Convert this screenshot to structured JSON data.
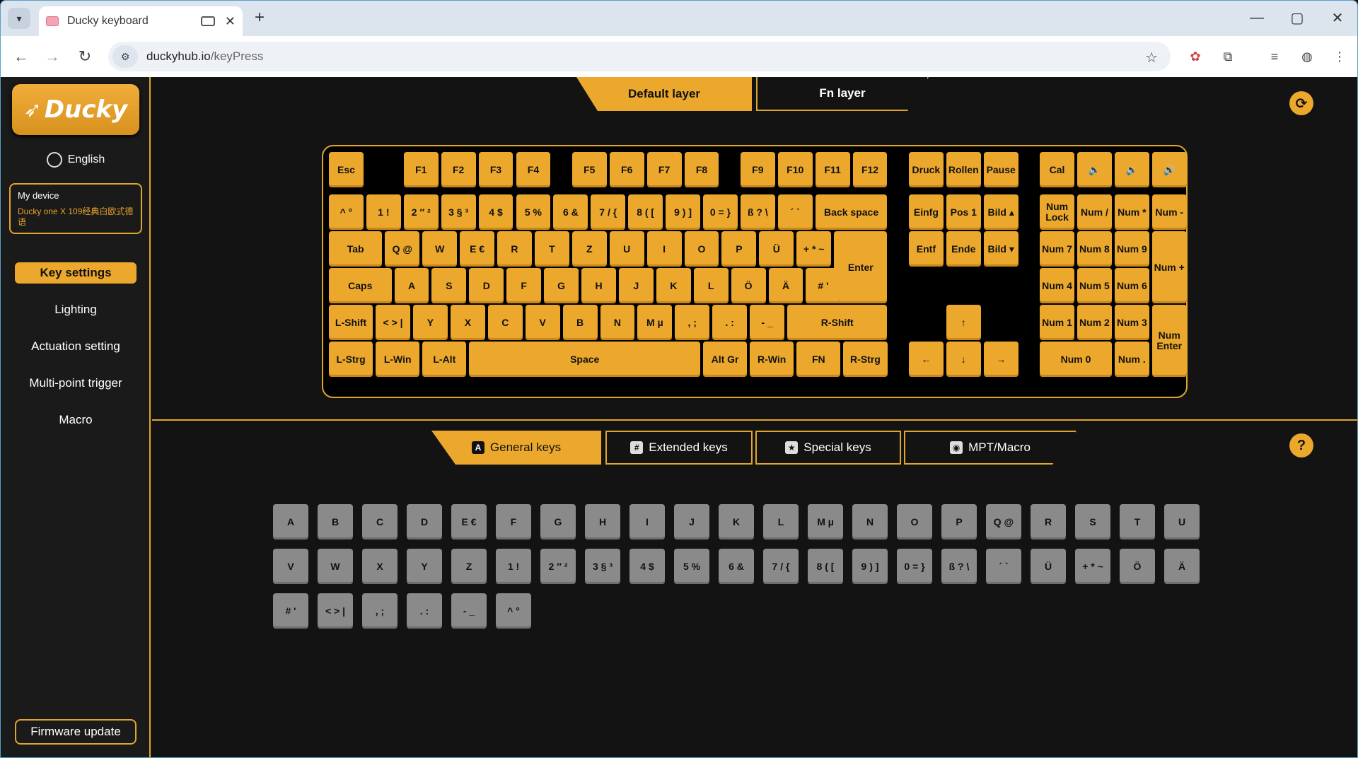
{
  "browser": {
    "tab_title": "Ducky keyboard",
    "url_domain": "duckyhub.io",
    "url_path": "/keyPress",
    "new_tab": "+",
    "tab_close": "✕"
  },
  "sidebar": {
    "logo": "Ducky",
    "language": "English",
    "device_title": "My device",
    "device_name": "Ducky one X 109经典白欧式德语",
    "items": [
      {
        "label": "Key settings",
        "active": true
      },
      {
        "label": "Lighting"
      },
      {
        "label": "Actuation setting"
      },
      {
        "label": "Multi-point trigger"
      },
      {
        "label": "Macro"
      }
    ],
    "firmware": "Firmware update"
  },
  "layers": {
    "default": "Default layer",
    "fn": "Fn layer"
  },
  "keyboard": {
    "keys": [
      {
        "label": "Esc",
        "r": 0,
        "c": 0,
        "w": 1
      },
      {
        "label": "F1",
        "r": 0,
        "c": 2,
        "w": 1
      },
      {
        "label": "F2",
        "r": 0,
        "c": 3,
        "w": 1
      },
      {
        "label": "F3",
        "r": 0,
        "c": 4,
        "w": 1
      },
      {
        "label": "F4",
        "r": 0,
        "c": 5,
        "w": 1
      },
      {
        "label": "F5",
        "r": 0,
        "c": 6.5,
        "w": 1
      },
      {
        "label": "F6",
        "r": 0,
        "c": 7.5,
        "w": 1
      },
      {
        "label": "F7",
        "r": 0,
        "c": 8.5,
        "w": 1
      },
      {
        "label": "F8",
        "r": 0,
        "c": 9.5,
        "w": 1
      },
      {
        "label": "F9",
        "r": 0,
        "c": 11,
        "w": 1
      },
      {
        "label": "F10",
        "r": 0,
        "c": 12,
        "w": 1
      },
      {
        "label": "F11",
        "r": 0,
        "c": 13,
        "w": 1
      },
      {
        "label": "F12",
        "r": 0,
        "c": 14,
        "w": 1
      },
      {
        "label": "^ °",
        "r": 1,
        "c": 0,
        "w": 1
      },
      {
        "label": "1 !",
        "r": 1,
        "c": 1,
        "w": 1
      },
      {
        "label": "2 ″ ²",
        "r": 1,
        "c": 2,
        "w": 1
      },
      {
        "label": "3 § ³",
        "r": 1,
        "c": 3,
        "w": 1
      },
      {
        "label": "4 $",
        "r": 1,
        "c": 4,
        "w": 1
      },
      {
        "label": "5 %",
        "r": 1,
        "c": 5,
        "w": 1
      },
      {
        "label": "6 &",
        "r": 1,
        "c": 6,
        "w": 1
      },
      {
        "label": "7 / {",
        "r": 1,
        "c": 7,
        "w": 1
      },
      {
        "label": "8 ( [",
        "r": 1,
        "c": 8,
        "w": 1
      },
      {
        "label": "9 ) ]",
        "r": 1,
        "c": 9,
        "w": 1
      },
      {
        "label": "0 = }",
        "r": 1,
        "c": 10,
        "w": 1
      },
      {
        "label": "ß ? \\",
        "r": 1,
        "c": 11,
        "w": 1
      },
      {
        "label": "´ `",
        "r": 1,
        "c": 12,
        "w": 1
      },
      {
        "label": "Back space",
        "r": 1,
        "c": 13,
        "w": 2
      },
      {
        "label": "Tab",
        "r": 2,
        "c": 0,
        "w": 1.5
      },
      {
        "label": "Q @",
        "r": 2,
        "c": 1.5,
        "w": 1
      },
      {
        "label": "W",
        "r": 2,
        "c": 2.5,
        "w": 1
      },
      {
        "label": "E €",
        "r": 2,
        "c": 3.5,
        "w": 1
      },
      {
        "label": "R",
        "r": 2,
        "c": 4.5,
        "w": 1
      },
      {
        "label": "T",
        "r": 2,
        "c": 5.5,
        "w": 1
      },
      {
        "label": "Z",
        "r": 2,
        "c": 6.5,
        "w": 1
      },
      {
        "label": "U",
        "r": 2,
        "c": 7.5,
        "w": 1
      },
      {
        "label": "I",
        "r": 2,
        "c": 8.5,
        "w": 1
      },
      {
        "label": "O",
        "r": 2,
        "c": 9.5,
        "w": 1
      },
      {
        "label": "P",
        "r": 2,
        "c": 10.5,
        "w": 1
      },
      {
        "label": "Ü",
        "r": 2,
        "c": 11.5,
        "w": 1
      },
      {
        "label": "+ * ~",
        "r": 2,
        "c": 12.5,
        "w": 1
      },
      {
        "label": "Enter",
        "r": 2,
        "c": 13.5,
        "w": 1.5,
        "h": 2
      },
      {
        "label": "Caps",
        "r": 3,
        "c": 0,
        "w": 1.75
      },
      {
        "label": "A",
        "r": 3,
        "c": 1.75,
        "w": 1
      },
      {
        "label": "S",
        "r": 3,
        "c": 2.75,
        "w": 1
      },
      {
        "label": "D",
        "r": 3,
        "c": 3.75,
        "w": 1
      },
      {
        "label": "F",
        "r": 3,
        "c": 4.75,
        "w": 1
      },
      {
        "label": "G",
        "r": 3,
        "c": 5.75,
        "w": 1
      },
      {
        "label": "H",
        "r": 3,
        "c": 6.75,
        "w": 1
      },
      {
        "label": "J",
        "r": 3,
        "c": 7.75,
        "w": 1
      },
      {
        "label": "K",
        "r": 3,
        "c": 8.75,
        "w": 1
      },
      {
        "label": "L",
        "r": 3,
        "c": 9.75,
        "w": 1
      },
      {
        "label": "Ö",
        "r": 3,
        "c": 10.75,
        "w": 1
      },
      {
        "label": "Ä",
        "r": 3,
        "c": 11.75,
        "w": 1
      },
      {
        "label": "# '",
        "r": 3,
        "c": 12.75,
        "w": 1
      },
      {
        "label": "L-Shift",
        "r": 4,
        "c": 0,
        "w": 1.25
      },
      {
        "label": "< > |",
        "r": 4,
        "c": 1.25,
        "w": 1
      },
      {
        "label": "Y",
        "r": 4,
        "c": 2.25,
        "w": 1
      },
      {
        "label": "X",
        "r": 4,
        "c": 3.25,
        "w": 1
      },
      {
        "label": "C",
        "r": 4,
        "c": 4.25,
        "w": 1
      },
      {
        "label": "V",
        "r": 4,
        "c": 5.25,
        "w": 1
      },
      {
        "label": "B",
        "r": 4,
        "c": 6.25,
        "w": 1
      },
      {
        "label": "N",
        "r": 4,
        "c": 7.25,
        "w": 1
      },
      {
        "label": "M µ",
        "r": 4,
        "c": 8.25,
        "w": 1
      },
      {
        "label": ", ;",
        "r": 4,
        "c": 9.25,
        "w": 1
      },
      {
        "label": ". :",
        "r": 4,
        "c": 10.25,
        "w": 1
      },
      {
        "label": "- _",
        "r": 4,
        "c": 11.25,
        "w": 1
      },
      {
        "label": "R-Shift",
        "r": 4,
        "c": 12.25,
        "w": 2.75
      },
      {
        "label": "L-Strg",
        "r": 5,
        "c": 0,
        "w": 1.25
      },
      {
        "label": "L-Win",
        "r": 5,
        "c": 1.25,
        "w": 1.25
      },
      {
        "label": "L-Alt",
        "r": 5,
        "c": 2.5,
        "w": 1.25
      },
      {
        "label": "Space",
        "r": 5,
        "c": 3.75,
        "w": 6.25
      },
      {
        "label": "Alt Gr",
        "r": 5,
        "c": 10,
        "w": 1.25
      },
      {
        "label": "R-Win",
        "r": 5,
        "c": 11.25,
        "w": 1.25
      },
      {
        "label": "FN",
        "r": 5,
        "c": 12.5,
        "w": 1.25
      },
      {
        "label": "R-Strg",
        "r": 5,
        "c": 13.75,
        "w": 1.25
      },
      {
        "label": "Druck",
        "r": 0,
        "c": 15.5,
        "w": 1
      },
      {
        "label": "Rollen",
        "r": 0,
        "c": 16.5,
        "w": 1
      },
      {
        "label": "Pause",
        "r": 0,
        "c": 17.5,
        "w": 1
      },
      {
        "label": "Einfg",
        "r": 1,
        "c": 15.5,
        "w": 1
      },
      {
        "label": "Pos 1",
        "r": 1,
        "c": 16.5,
        "w": 1
      },
      {
        "label": "Bild ▴",
        "r": 1,
        "c": 17.5,
        "w": 1
      },
      {
        "label": "Entf",
        "r": 2,
        "c": 15.5,
        "w": 1
      },
      {
        "label": "Ende",
        "r": 2,
        "c": 16.5,
        "w": 1
      },
      {
        "label": "Bild ▾",
        "r": 2,
        "c": 17.5,
        "w": 1
      },
      {
        "label": "↑",
        "r": 4,
        "c": 16.5,
        "w": 1
      },
      {
        "label": "←",
        "r": 5,
        "c": 15.5,
        "w": 1
      },
      {
        "label": "↓",
        "r": 5,
        "c": 16.5,
        "w": 1
      },
      {
        "label": "→",
        "r": 5,
        "c": 17.5,
        "w": 1
      },
      {
        "label": "Cal",
        "r": 0,
        "c": 19,
        "w": 1
      },
      {
        "label": "🔈",
        "r": 0,
        "c": 20,
        "w": 1
      },
      {
        "label": "🔉",
        "r": 0,
        "c": 21,
        "w": 1
      },
      {
        "label": "🔊",
        "r": 0,
        "c": 22,
        "w": 1
      },
      {
        "label": "Num Lock",
        "r": 1,
        "c": 19,
        "w": 1
      },
      {
        "label": "Num /",
        "r": 1,
        "c": 20,
        "w": 1
      },
      {
        "label": "Num *",
        "r": 1,
        "c": 21,
        "w": 1
      },
      {
        "label": "Num -",
        "r": 1,
        "c": 22,
        "w": 1
      },
      {
        "label": "Num 7",
        "r": 2,
        "c": 19,
        "w": 1
      },
      {
        "label": "Num 8",
        "r": 2,
        "c": 20,
        "w": 1
      },
      {
        "label": "Num 9",
        "r": 2,
        "c": 21,
        "w": 1
      },
      {
        "label": "Num +",
        "r": 2,
        "c": 22,
        "w": 1,
        "h": 2
      },
      {
        "label": "Num 4",
        "r": 3,
        "c": 19,
        "w": 1
      },
      {
        "label": "Num 5",
        "r": 3,
        "c": 20,
        "w": 1
      },
      {
        "label": "Num 6",
        "r": 3,
        "c": 21,
        "w": 1
      },
      {
        "label": "Num 1",
        "r": 4,
        "c": 19,
        "w": 1
      },
      {
        "label": "Num 2",
        "r": 4,
        "c": 20,
        "w": 1
      },
      {
        "label": "Num 3",
        "r": 4,
        "c": 21,
        "w": 1
      },
      {
        "label": "Num Enter",
        "r": 4,
        "c": 22,
        "w": 1,
        "h": 2
      },
      {
        "label": "Num 0",
        "r": 5,
        "c": 19,
        "w": 2
      },
      {
        "label": "Num .",
        "r": 5,
        "c": 21,
        "w": 1
      }
    ]
  },
  "categories": {
    "general": {
      "icon": "A",
      "label": "General keys"
    },
    "extended": {
      "icon": "#",
      "label": "Extended keys"
    },
    "special": {
      "icon": "★",
      "label": "Special keys"
    },
    "macro": {
      "icon": "◉",
      "label": "MPT/Macro"
    }
  },
  "general_keys": [
    "A",
    "B",
    "C",
    "D",
    "E €",
    "F",
    "G",
    "H",
    "I",
    "J",
    "K",
    "L",
    "M µ",
    "N",
    "O",
    "P",
    "Q @",
    "R",
    "S",
    "T",
    "U",
    "V",
    "W",
    "X",
    "Y",
    "Z",
    "1 !",
    "2 ″ ²",
    "3 § ³",
    "4 $",
    "5 %",
    "6 &",
    "7 / {",
    "8 ( [",
    "9 ) ]",
    "0 = }",
    "ß ? \\",
    "´ `",
    "Ü",
    "+ * ~",
    "Ö",
    "Ä",
    "# '",
    "< > |",
    ", ;",
    ". :",
    "- _",
    "^ °"
  ],
  "colors": {
    "accent": "#eba82d",
    "key_gray": "#8a8a8a"
  }
}
